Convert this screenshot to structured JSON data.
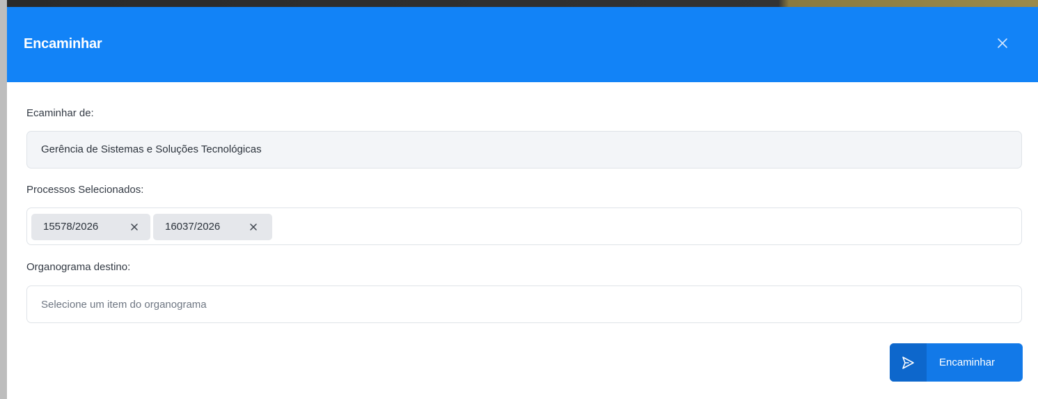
{
  "dialog": {
    "title": "Encaminhar"
  },
  "fields": {
    "from": {
      "label": "Ecaminhar de:",
      "value": "Gerência de Sistemas e Soluções Tecnológicas"
    },
    "processes": {
      "label": "Processos Selecionados:",
      "chips": [
        "15578/2026",
        "16037/2026"
      ]
    },
    "destination": {
      "label": "Organograma destino:",
      "placeholder": "Selecione um item do organograma"
    }
  },
  "actions": {
    "submit_label": "Encaminhar",
    "submit_icon": "send-icon",
    "close_icon": "close-icon"
  },
  "colors": {
    "header": "#1283f7",
    "primary_button": "#1279e8",
    "chip_bg": "#e5e7eb"
  }
}
